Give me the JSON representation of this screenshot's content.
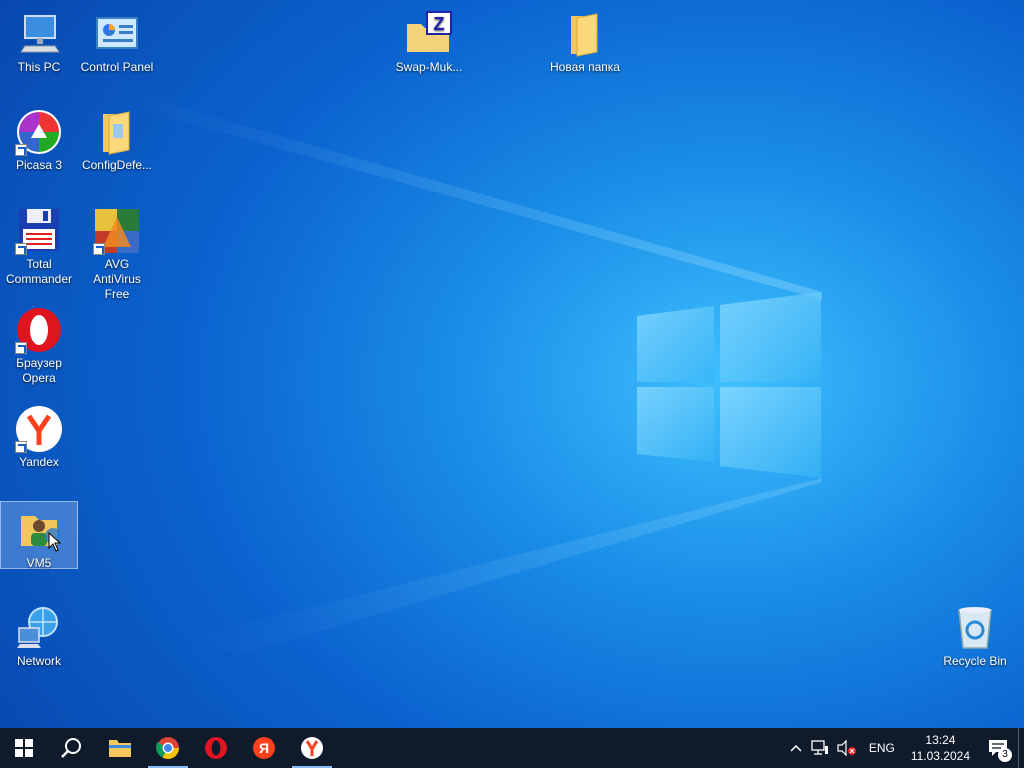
{
  "desktop": {
    "icons": {
      "this_pc": "This PC",
      "control_panel": "Control Panel",
      "swap": "Swap-Muk...",
      "new_folder": "Новая папка",
      "picasa": "Picasa 3",
      "configdefe": "ConfigDefe...",
      "total_commander_1": "Total",
      "total_commander_2": "Commander",
      "avg_1": "AVG AntiVirus",
      "avg_2": "Free",
      "opera_1": "Браузер",
      "opera_2": "Opera",
      "yandex": "Yandex",
      "vm5": "VM5",
      "network": "Network",
      "recycle_bin": "Recycle Bin"
    }
  },
  "taskbar": {
    "pinned": [
      "windows-start-icon",
      "search-icon",
      "file-explorer-icon",
      "chrome-icon",
      "opera-icon",
      "yandex-ya-icon",
      "yandex-browser-icon"
    ],
    "tray": {
      "language": "ENG",
      "time": "13:24",
      "date": "11.03.2024",
      "notification_count": "3"
    }
  },
  "colors": {
    "wallpaper_blue": "#0b63cf",
    "taskbar": "#0f1a2b",
    "opera_red": "#e0141e",
    "yandex_red": "#fc3f1d"
  }
}
